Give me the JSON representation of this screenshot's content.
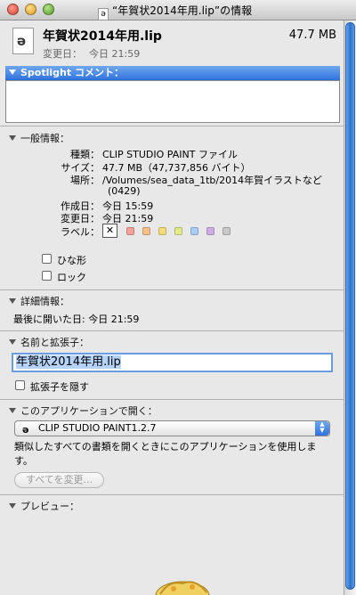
{
  "window": {
    "title": "“年賀状2014年用.lip”の情報"
  },
  "header": {
    "file_name": "年賀状2014年用.lip",
    "file_size": "47.7 MB",
    "modified_label": "変更日：",
    "modified_value": "今日 21:59"
  },
  "spotlight": {
    "title": "Spotlight コメント："
  },
  "general": {
    "title": "一般情報：",
    "rows": [
      {
        "key": "種類：",
        "value": "CLIP STUDIO PAINT ファイル"
      },
      {
        "key": "サイズ：",
        "value": "47.7 MB（47,737,856 バイト）"
      },
      {
        "key": "場所：",
        "value": "/Volumes/sea_data_1tb/2014年賀イラストなど"
      },
      {
        "key": "",
        "value": "(0429)"
      },
      {
        "key": "作成日：",
        "value": "今日 15:59"
      },
      {
        "key": "変更日：",
        "value": "今日 21:59"
      },
      {
        "key": "ラベル：",
        "value": ""
      }
    ],
    "label_none": "✕",
    "label_colors": [
      "#f2a09a",
      "#f5c08a",
      "#f2dc7e",
      "#e2ea8a",
      "#a9cdf4",
      "#cfaee6",
      "#c8c8c8"
    ],
    "stationery_label": "ひな形",
    "locked_label": "ロック"
  },
  "more": {
    "title": "詳細情報：",
    "last_opened": "最後に開いた日: 今日 21:59"
  },
  "name_ext": {
    "title": "名前と拡張子：",
    "field_value": "年賀状2014年用.lip",
    "hide_ext_label": "拡張子を隠す"
  },
  "open_with": {
    "title": "このアプリケーションで開く：",
    "app": "CLIP STUDIO PAINT1.2.7",
    "description": "類似したすべての書類を開くときにこのアプリケーションを使用します。",
    "change_all": "すべてを変更..."
  },
  "preview": {
    "title": "プレビュー："
  }
}
